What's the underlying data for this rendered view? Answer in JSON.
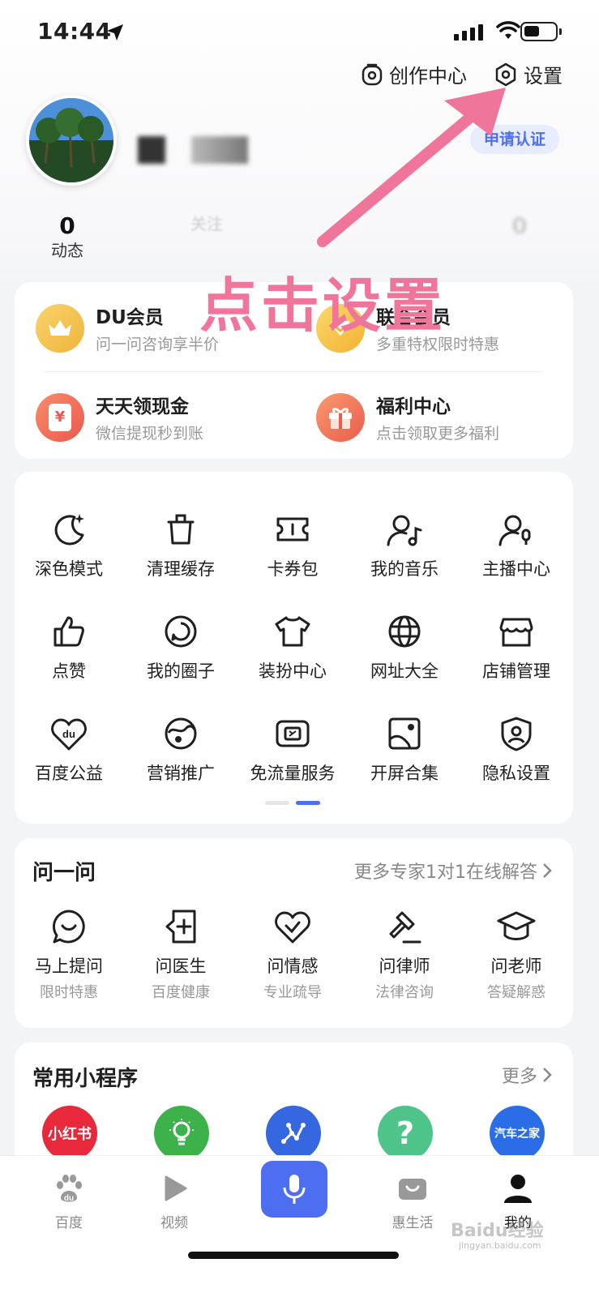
{
  "status_bar": {
    "time": "14:44"
  },
  "header": {
    "creator_center": "创作中心",
    "settings": "设置"
  },
  "profile": {
    "verify_button": "申请认证"
  },
  "stats": [
    {
      "num": "0",
      "label": "动态"
    },
    {
      "num": "",
      "label": "关注"
    },
    {
      "num": "",
      "label": ""
    },
    {
      "num": "0",
      "label": ""
    }
  ],
  "annotation": {
    "text": "点击设置",
    "color": "#f0759a"
  },
  "vip": [
    {
      "title": "DU会员",
      "sub": "问一问咨询享半价",
      "icon": "crown-icon"
    },
    {
      "title": "联合会员",
      "sub": "多重特权限时特惠",
      "icon": "gift-badge-icon"
    },
    {
      "title": "天天领现金",
      "sub": "微信提现秒到账",
      "icon": "cash-icon",
      "icon_text": "¥"
    },
    {
      "title": "福利中心",
      "sub": "点击领取更多福利",
      "icon": "gift-icon"
    }
  ],
  "tools": [
    {
      "label": "深色模式",
      "icon": "moon-icon"
    },
    {
      "label": "清理缓存",
      "icon": "trash-icon"
    },
    {
      "label": "卡券包",
      "icon": "coupon-icon"
    },
    {
      "label": "我的音乐",
      "icon": "music-icon"
    },
    {
      "label": "主播中心",
      "icon": "anchor-icon"
    },
    {
      "label": "点赞",
      "icon": "thumbs-up-icon"
    },
    {
      "label": "我的圈子",
      "icon": "circle-icon"
    },
    {
      "label": "装扮中心",
      "icon": "shirt-icon"
    },
    {
      "label": "网址大全",
      "icon": "globe-icon"
    },
    {
      "label": "店铺管理",
      "icon": "shop-icon"
    },
    {
      "label": "百度公益",
      "icon": "heart-du-icon"
    },
    {
      "label": "营销推广",
      "icon": "promotion-icon"
    },
    {
      "label": "免流量服务",
      "icon": "sim-card-icon"
    },
    {
      "label": "开屏合集",
      "icon": "image-icon"
    },
    {
      "label": "隐私设置",
      "icon": "shield-user-icon"
    }
  ],
  "ask": {
    "title": "问一问",
    "more": "更多专家1对1在线解答",
    "items": [
      {
        "label": "马上提问",
        "sub": "限时特惠",
        "icon": "chat-icon"
      },
      {
        "label": "问医生",
        "sub": "百度健康",
        "icon": "medical-icon"
      },
      {
        "label": "问情感",
        "sub": "专业疏导",
        "icon": "heart-check-icon"
      },
      {
        "label": "问律师",
        "sub": "法律咨询",
        "icon": "gavel-icon"
      },
      {
        "label": "问老师",
        "sub": "答疑解惑",
        "icon": "graduation-cap-icon"
      }
    ]
  },
  "mini_programs": {
    "title": "常用小程序",
    "more": "更多",
    "items": [
      {
        "text": "小红书",
        "color": "#e8283b",
        "icon": "xiaohongshu-icon"
      },
      {
        "text": "",
        "color": "#3db24b",
        "icon": "bulb-icon"
      },
      {
        "text": "",
        "color": "#3567e0",
        "icon": "network-icon"
      },
      {
        "text": "?",
        "color": "#4fc48a",
        "icon": "question-icon"
      },
      {
        "text": "汽车之家",
        "color": "#2b6de6",
        "icon": "autohome-icon"
      }
    ]
  },
  "tabbar": [
    {
      "label": "百度",
      "icon": "baidu-paw-icon"
    },
    {
      "label": "视频",
      "icon": "play-icon"
    },
    {
      "label": "",
      "icon": "mic-icon"
    },
    {
      "label": "惠生活",
      "icon": "life-icon"
    },
    {
      "label": "我的",
      "icon": "user-icon"
    }
  ],
  "watermark": {
    "brand": "Baidu经验",
    "url": "jingyan.baidu.com"
  }
}
